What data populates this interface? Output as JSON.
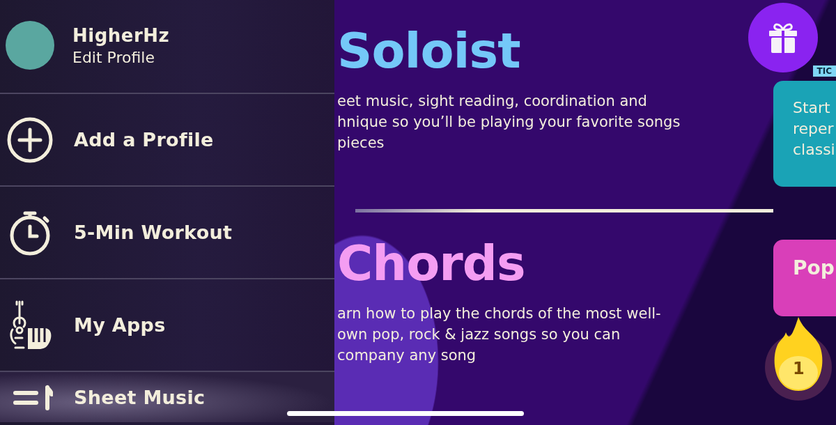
{
  "profile": {
    "name": "HigherHz",
    "action": "Edit Profile"
  },
  "menu": [
    {
      "label": "Add a Profile",
      "selected": false
    },
    {
      "label": "5-Min Workout",
      "selected": false
    },
    {
      "label": "My Apps",
      "selected": false
    },
    {
      "label": "Sheet Music",
      "selected": true
    }
  ],
  "sections": [
    {
      "title": "Soloist",
      "color": "#74c8f8",
      "description": "eet music, sight reading, coordination and\nhnique so you’ll be playing your favorite songs\npieces"
    },
    {
      "title": "Chords",
      "color": "#f49df2",
      "description": "arn how to play the chords of the most well-\nown pop, rock & jazz songs so you can\ncompany any song"
    }
  ],
  "cards": [
    {
      "tag": "TIC",
      "text": [
        "Start",
        "reper",
        "classi"
      ],
      "color": "#1aa3b6"
    },
    {
      "title": "Pop",
      "color": "#d93fb9"
    }
  ],
  "streak": {
    "count": "1"
  }
}
